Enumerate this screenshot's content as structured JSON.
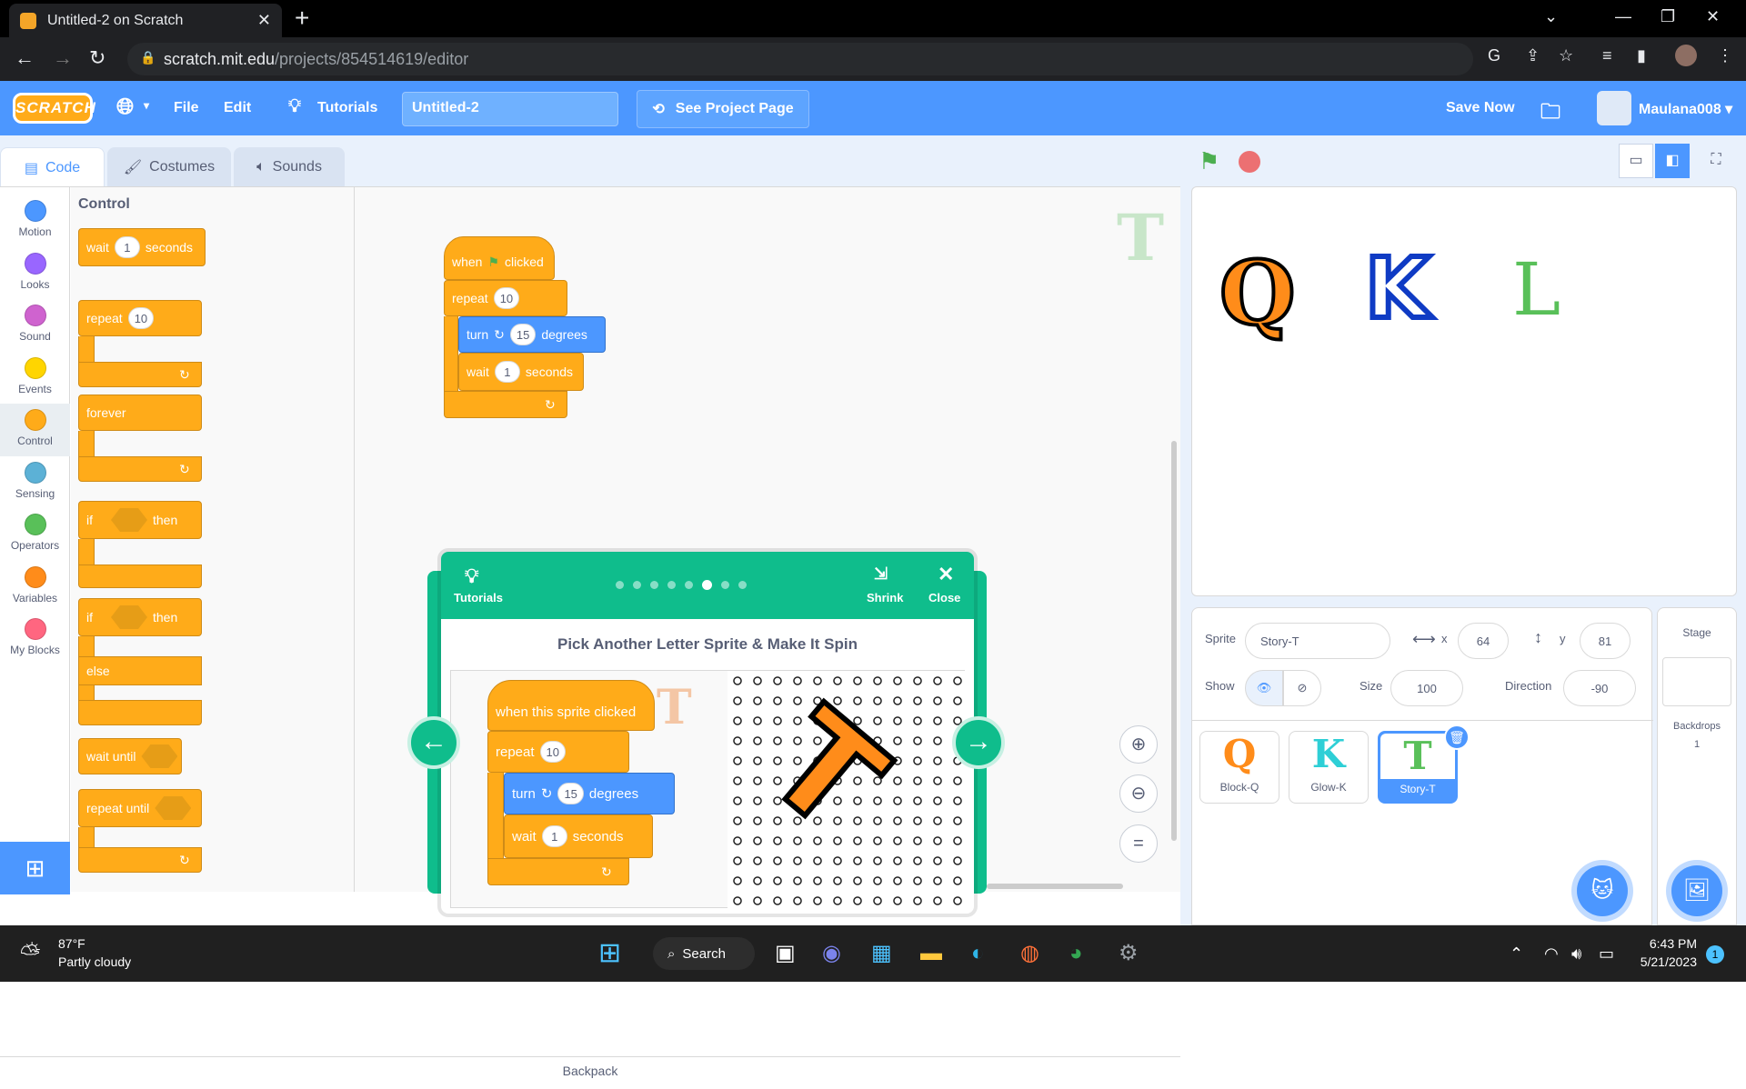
{
  "browser": {
    "tab_title": "Untitled-2 on Scratch",
    "url_host": "scratch.mit.edu",
    "url_path": "/projects/854514619/editor"
  },
  "menu": {
    "logo": "SCRATCH",
    "file": "File",
    "edit": "Edit",
    "tutorials": "Tutorials",
    "project_title": "Untitled-2",
    "see_project_page": "See Project Page",
    "save_now": "Save Now",
    "username": "Maulana008"
  },
  "editor_tabs": {
    "code": "Code",
    "costumes": "Costumes",
    "sounds": "Sounds"
  },
  "categories": [
    {
      "label": "Motion",
      "color": "#4c97ff"
    },
    {
      "label": "Looks",
      "color": "#9966ff"
    },
    {
      "label": "Sound",
      "color": "#cf63cf"
    },
    {
      "label": "Events",
      "color": "#ffd500"
    },
    {
      "label": "Control",
      "color": "#ffab19"
    },
    {
      "label": "Sensing",
      "color": "#5cb1d6"
    },
    {
      "label": "Operators",
      "color": "#59c059"
    },
    {
      "label": "Variables",
      "color": "#ff8c1a"
    },
    {
      "label": "My Blocks",
      "color": "#ff6680"
    }
  ],
  "palette": {
    "title": "Control",
    "wait": "wait",
    "wait_val": "1",
    "seconds": "seconds",
    "repeat": "repeat",
    "repeat_val": "10",
    "forever": "forever",
    "if": "if",
    "then": "then",
    "else": "else",
    "wait_until": "wait until",
    "repeat_until": "repeat until"
  },
  "script": {
    "when": "when",
    "clicked": "clicked",
    "repeat": "repeat",
    "repeat_val": "10",
    "turn": "turn",
    "turn_val": "15",
    "degrees": "degrees",
    "wait": "wait",
    "wait_val": "1",
    "seconds": "seconds"
  },
  "backpack": "Backpack",
  "tutorial": {
    "label": "Tutorials",
    "shrink": "Shrink",
    "close": "Close",
    "step_count": 8,
    "current_step": 6,
    "title": "Pick Another Letter Sprite & Make It Spin",
    "hat": "when this sprite clicked",
    "repeat": "repeat",
    "repeat_val": "10",
    "turn": "turn",
    "turn_val": "15",
    "degrees": "degrees",
    "wait": "wait",
    "wait_val": "1",
    "seconds": "seconds"
  },
  "sprite_info": {
    "sprite_label": "Sprite",
    "sprite_name": "Story-T",
    "x_label": "x",
    "x_val": "64",
    "y_label": "y",
    "y_val": "81",
    "show_label": "Show",
    "size_label": "Size",
    "size_val": "100",
    "direction_label": "Direction",
    "direction_val": "-90"
  },
  "sprites": [
    {
      "name": "Block-Q",
      "glyph": "Q",
      "color": "#ff8c1a"
    },
    {
      "name": "Glow-K",
      "glyph": "K",
      "color": "#2ecfd6"
    },
    {
      "name": "Story-T",
      "glyph": "T",
      "color": "#59c059"
    }
  ],
  "stage_pane": {
    "title": "Stage",
    "backdrops_label": "Backdrops",
    "backdrops_count": "1"
  },
  "stage_letters": {
    "q": "Q",
    "k": "K",
    "l": "L"
  },
  "taskbar": {
    "temp": "87°F",
    "weather": "Partly cloudy",
    "search": "Search",
    "time": "6:43 PM",
    "date": "5/21/2023",
    "notif": "1"
  }
}
